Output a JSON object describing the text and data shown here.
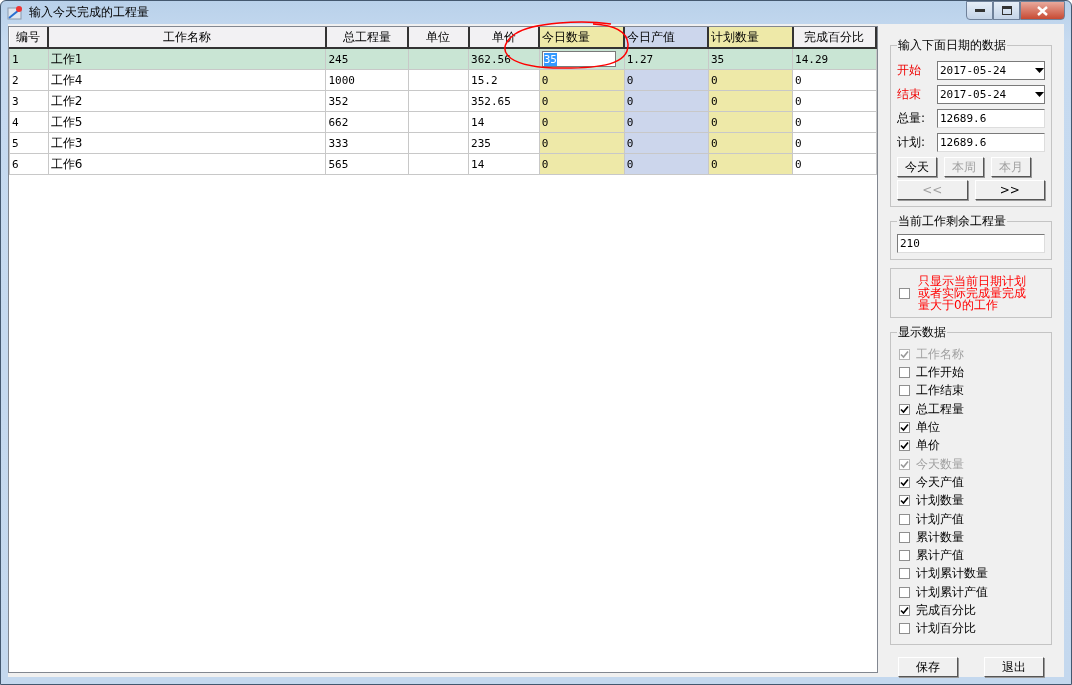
{
  "window": {
    "title": "输入今天完成的工程量"
  },
  "table": {
    "columns": [
      {
        "label": "编号"
      },
      {
        "label": "工作名称"
      },
      {
        "label": "总工程量"
      },
      {
        "label": "单位"
      },
      {
        "label": "单价"
      },
      {
        "label": "今日数量",
        "color": "#eee9a8",
        "editing": true
      },
      {
        "label": "今日产值",
        "color": "#ccd6ec"
      },
      {
        "label": "计划数量",
        "color": "#eee9a8"
      },
      {
        "label": "完成百分比"
      }
    ],
    "rows": [
      {
        "selected": true,
        "cells": [
          "1",
          "工作1",
          "245",
          null,
          "362.56",
          "35",
          "1.27",
          "35",
          "14.29"
        ]
      },
      {
        "selected": false,
        "cells": [
          "2",
          "工作4",
          "1000",
          null,
          "15.2",
          "0",
          "0",
          "0",
          "0"
        ]
      },
      {
        "selected": false,
        "cells": [
          "3",
          "工作2",
          "352",
          null,
          "352.65",
          "0",
          "0",
          "0",
          "0"
        ]
      },
      {
        "selected": false,
        "cells": [
          "4",
          "工作5",
          "662",
          null,
          "14",
          "0",
          "0",
          "0",
          "0"
        ]
      },
      {
        "selected": false,
        "cells": [
          "5",
          "工作3",
          "333",
          null,
          "235",
          "0",
          "0",
          "0",
          "0"
        ]
      },
      {
        "selected": false,
        "cells": [
          "6",
          "工作6",
          "565",
          null,
          "14",
          "0",
          "0",
          "0",
          "0"
        ]
      }
    ]
  },
  "date_group": {
    "title": "输入下面日期的数据",
    "start": {
      "label": "开始",
      "value": "2017-05-24"
    },
    "end": {
      "label": "结束",
      "value": "2017-05-24"
    },
    "total": {
      "label": "总量:",
      "value": "12689.6"
    },
    "plan": {
      "label": "计划:",
      "value": "12689.6"
    },
    "period_buttons": [
      {
        "label": "今天",
        "disabled": false
      },
      {
        "label": "本周",
        "disabled": true
      },
      {
        "label": "本月",
        "disabled": true
      }
    ],
    "nav_buttons": [
      {
        "label": "<<",
        "disabled": true
      },
      {
        "label": ">>",
        "disabled": false
      }
    ]
  },
  "remaining_group": {
    "title": "当前工作剩余工程量",
    "value": "210"
  },
  "filter": {
    "label": "只显示当前日期计划或者实际完成量完成量大于0的工作",
    "checked": false
  },
  "display_group": {
    "title": "显示数据",
    "items": [
      {
        "label": "工作名称",
        "checked": true,
        "disabled": true
      },
      {
        "label": "工作开始",
        "checked": false,
        "disabled": false
      },
      {
        "label": "工作结束",
        "checked": false,
        "disabled": false
      },
      {
        "label": "总工程量",
        "checked": true,
        "disabled": false
      },
      {
        "label": "单位",
        "checked": true,
        "disabled": false
      },
      {
        "label": "单价",
        "checked": true,
        "disabled": false
      },
      {
        "label": "今天数量",
        "checked": true,
        "disabled": true
      },
      {
        "label": "今天产值",
        "checked": true,
        "disabled": false
      },
      {
        "label": "计划数量",
        "checked": true,
        "disabled": false
      },
      {
        "label": "计划产值",
        "checked": false,
        "disabled": false
      },
      {
        "label": "累计数量",
        "checked": false,
        "disabled": false
      },
      {
        "label": "累计产值",
        "checked": false,
        "disabled": false
      },
      {
        "label": "计划累计数量",
        "checked": false,
        "disabled": false
      },
      {
        "label": "计划累计产值",
        "checked": false,
        "disabled": false
      },
      {
        "label": "完成百分比",
        "checked": true,
        "disabled": false
      },
      {
        "label": "计划百分比",
        "checked": false,
        "disabled": false
      }
    ]
  },
  "buttons": [
    "保存",
    "退出"
  ]
}
